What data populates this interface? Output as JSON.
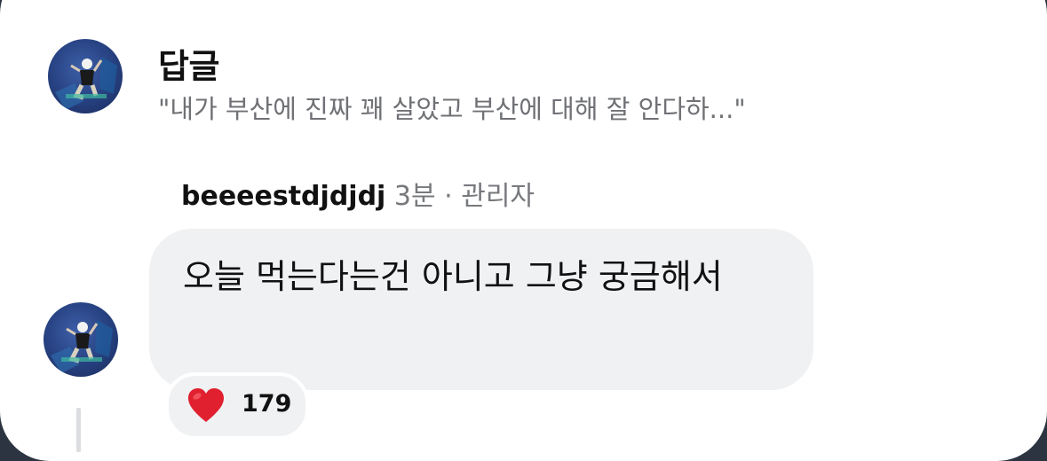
{
  "header": {
    "title": "답글",
    "quote": "\"내가 부산에 진짜 꽤 살았고 부산에 대해 잘 안다하...\""
  },
  "reply": {
    "username": "beeeestdjdjdj",
    "time": "3분",
    "separator": "·",
    "role": "관리자",
    "text": "오늘 먹는다는건 아니고 그냥 궁금해서",
    "reaction": {
      "icon": "heart-icon",
      "count": "179"
    }
  },
  "colors": {
    "bubble": "#f0f1f3",
    "muted_text": "#77797d",
    "heart": "#e0202e"
  }
}
